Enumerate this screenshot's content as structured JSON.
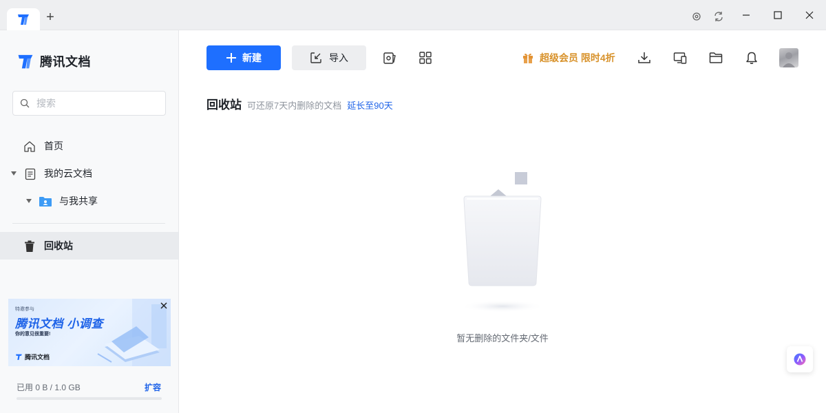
{
  "app": {
    "name": "腾讯文档",
    "accent": "#1e6fff"
  },
  "titlebar": {
    "new_tab": "+",
    "icons": [
      "settings-icon",
      "refresh-icon",
      "minimize-icon",
      "maximize-icon",
      "close-icon"
    ]
  },
  "sidebar": {
    "brand": "腾讯文档",
    "search_placeholder": "搜索",
    "items": [
      {
        "label": "首页",
        "icon": "home-icon"
      },
      {
        "label": "我的云文档",
        "icon": "document-icon"
      },
      {
        "label": "与我共享",
        "icon": "shared-folder-icon"
      },
      {
        "label": "回收站",
        "icon": "trash-icon",
        "active": true
      }
    ],
    "banner": {
      "line1": "特邀参与",
      "title": "腾讯文档 小调查",
      "line2": "你的意见很重要!",
      "brand": "腾讯文档"
    },
    "storage": {
      "used_text": "已用 0 B / 1.0 GB",
      "expand": "扩容",
      "used_fraction": 0
    }
  },
  "toolbar": {
    "new_label": "新建",
    "import_label": "导入",
    "vip_label": "超级会员 限时4折",
    "vip_color": "#d8922b"
  },
  "main": {
    "title": "回收站",
    "subtitle": "可还原7天内删除的文档",
    "link": "延长至90天",
    "empty_text": "暂无删除的文件夹/文件"
  }
}
